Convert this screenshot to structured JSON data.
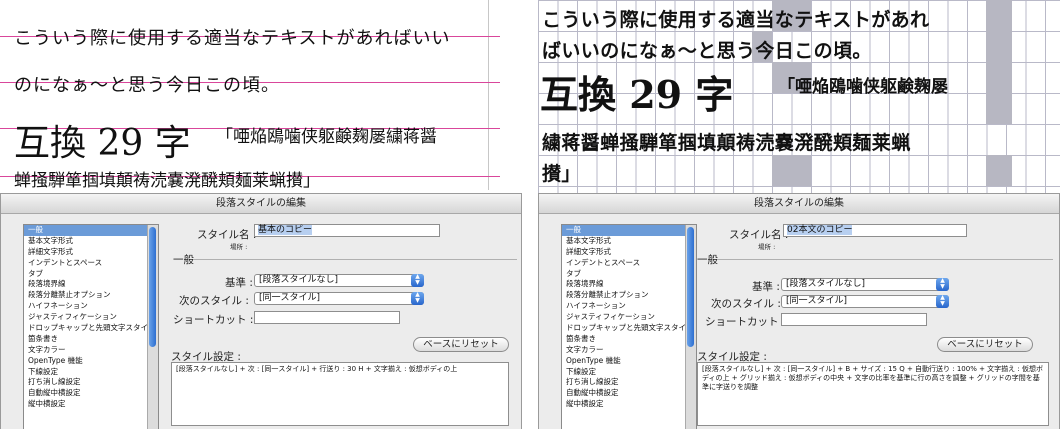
{
  "left": {
    "sample": {
      "line1": "こういう際に使用する適当なテキストがあればいい",
      "line2": "のになぁ～と思う今日この頃。",
      "big": "互換 29 字",
      "big_small": "「唖焔鴎噛侠躯鹸麹屡繍蒋醤",
      "line4": "蝉掻騨箪掴填顛祷涜嚢溌醗頬麺莱蝋攅」"
    },
    "dialog": {
      "title": "段落スタイルの編集",
      "style_name_label": "スタイル名 :",
      "style_name_value": "基本のコピー",
      "location_label": "場所 :",
      "section_general": "一般",
      "base_label": "基準 :",
      "base_value": "[段落スタイルなし]",
      "next_label": "次のスタイル :",
      "next_value": "[同一スタイル]",
      "shortcut_label": "ショートカット :",
      "reset_button": "ベースにリセット",
      "settings_label": "スタイル設定 :",
      "settings_text": "[段落スタイルなし] + 次 : [同一スタイル] + 行送り : 30 H + 文字揃え : 仮想ボディの上",
      "categories": [
        "一般",
        "基本文字形式",
        "詳細文字形式",
        "インデントとスペース",
        "タブ",
        "段落境界線",
        "段落分離禁止オプション",
        "ハイフネーション",
        "ジャスティフィケーション",
        "ドロップキャップと先頭文字スタイル",
        "箇条書き",
        "文字カラー",
        "OpenType 機能",
        "下線設定",
        "打ち消し線設定",
        "自動縦中横設定",
        "縦中横設定"
      ]
    }
  },
  "right": {
    "sample": {
      "line1": "こういう際に使用する適当なテキストがあれ",
      "line2": "ばいいのになぁ～と思う今日この頃。",
      "big": "互換 29 字",
      "big_small": "「唖焔鴎噛侠躯鹸麹屡",
      "line4": "繍蒋醤蝉掻騨箪掴填顛祷涜嚢溌醗頬麺莱蝋",
      "line5": "攅」"
    },
    "dialog": {
      "title": "段落スタイルの編集",
      "style_name_label": "スタイル名 :",
      "style_name_value": "02本文のコピー",
      "location_label": "場所 :",
      "section_general": "一般",
      "base_label": "基準 :",
      "base_value": "[段落スタイルなし]",
      "next_label": "次のスタイル :",
      "next_value": "[同一スタイル]",
      "shortcut_label": "ショートカット :",
      "reset_button": "ベースにリセット",
      "settings_label": "スタイル設定 :",
      "settings_text": "[段落スタイルなし] + 次 : [同一スタイル] + B + サイズ : 15 Q + 自動行送り : 100% + 文字揃え : 仮想ボディの上 + グリッド揃え : 仮想ボディの中央 + 文字の比率を基準に行の高さを調整 + グリッドの字間を基準に字送りを調整",
      "categories": [
        "一般",
        "基本文字形式",
        "詳細文字形式",
        "インデントとスペース",
        "タブ",
        "段落境界線",
        "段落分離禁止オプション",
        "ハイフネーション",
        "ジャスティフィケーション",
        "ドロップキャップと先頭文字スタイル",
        "箇条書き",
        "文字カラー",
        "OpenType 機能",
        "下線設定",
        "打ち消し線設定",
        "自動縦中横設定",
        "縦中横設定"
      ]
    }
  },
  "colors": {
    "guide_line": "#d9469b",
    "selection": "#6b9bd8",
    "grid_shade": "#b7b7c2",
    "popup_arrow": "#2866cc"
  },
  "icons": {
    "popup_arrows": "up-down-arrows-icon"
  }
}
